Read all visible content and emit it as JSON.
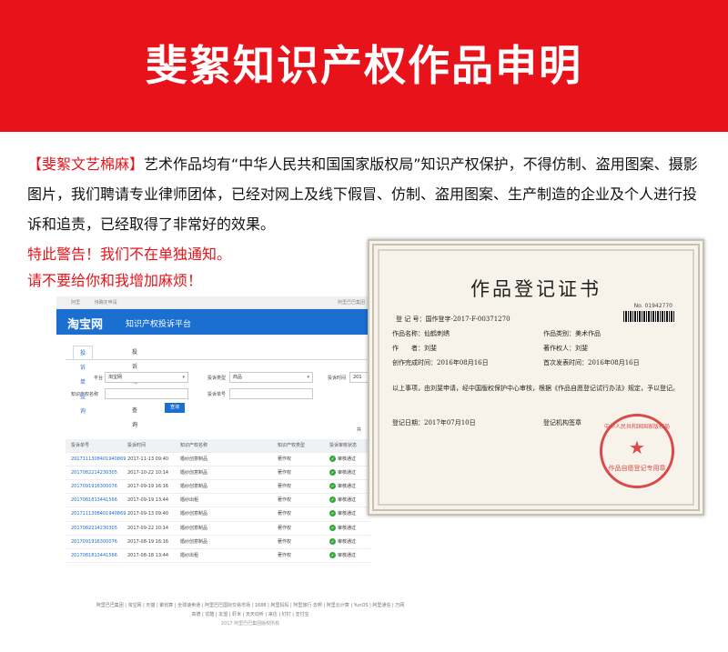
{
  "banner": {
    "title": "斐絮知识产权作品申明"
  },
  "intro": {
    "brand": "【斐絮文艺棉麻】",
    "text": "艺术作品均有“中华人民共和国国家版权局”知识产权保护，不得仿制、盗用图案、摄影图片，我们聘请专业律师团体，已经对网上及线下假冒、仿制、盗用图案、生产制造的企业及个人进行投诉和追责，已经取得了非常好的效果。"
  },
  "warnings": [
    "特此警告！我们不在单独通知。",
    "请不要给你和我增加麻烦！"
  ],
  "taobao": {
    "top_left": "阿里",
    "top_mid": "待确定申请",
    "top_right": "阿里巴巴集团",
    "logo": "淘宝网",
    "subtitle": "知识产权投诉平台",
    "tabs": [
      "投诉单查询",
      "投诉链接查询"
    ],
    "filters": {
      "platform_label": "平台",
      "platform_value": "淘宝网",
      "type_label": "投诉类型",
      "type_value": "商品",
      "time_label": "投诉时间",
      "time_value": "201",
      "ip_label": "知识产权名称",
      "no_label": "投诉单号",
      "search_button": "查询"
    },
    "table_hint": "共",
    "headers": [
      "投诉单号",
      "投诉时间",
      "知识产权名称",
      "知识产权类型",
      "投诉审核状态"
    ],
    "rows": [
      {
        "id": "2017111308401940869",
        "time": "2017-11-13 09:40",
        "name": "婚纱创意制品",
        "type": "著作权",
        "status": "审核通过",
        "action": ""
      },
      {
        "id": "2017082214230305",
        "time": "2017-10-22 10:14",
        "name": "婚纱创意制品",
        "type": "著作权",
        "status": "审核通过",
        "action": ""
      },
      {
        "id": "2017091916300076",
        "time": "2017-09-19 16:16",
        "name": "婚纱创意制品",
        "type": "著作权",
        "status": "审核通过",
        "action": ""
      },
      {
        "id": "2017081813441566",
        "time": "2017-09-19 13:44",
        "name": "婚纱出租",
        "type": "著作权",
        "status": "审核通过",
        "action": "查看"
      },
      {
        "id": "2017111308401940869",
        "time": "2017-09-13 09:40",
        "name": "婚纱创意制品",
        "type": "著作权",
        "status": "审核通过",
        "action": "查看"
      },
      {
        "id": "2017082214230305",
        "time": "2017-09-22 10:14",
        "name": "婚纱创意制品",
        "type": "著作权",
        "status": "审核通过",
        "action": "查看"
      },
      {
        "id": "2017091916300076",
        "time": "2017-08-19 16:16",
        "name": "婚纱创意制品",
        "type": "著作权",
        "status": "审核通过",
        "action": "查看"
      },
      {
        "id": "2017081813441566",
        "time": "2017-08-18 13:44",
        "name": "婚纱出租",
        "type": "著作权",
        "status": "审核通过",
        "action": "查看"
      }
    ],
    "footer1": "阿里巴巴集团 | 淘宝网 | 天猫 | 聚划算 | 全球速卖通 | 阿里巴巴国际交易市场 | 1688 | 阿里妈妈 | 阿里旅行·去啊 | 阿里云计算 | YunOS | 阿里通信 | 万网",
    "footer2": "高德 | 优酷 | 友盟 | 虾米 | 天天动听 | 来往 | 钉钉 | 支付宝",
    "footer3": "2017 阿里巴巴集团版权所有"
  },
  "certificate": {
    "title": "作品登记证书",
    "no": "No. 01942770",
    "reg_no": "登 记 号：国作登字-2017-F-00371270",
    "work_name": "作品名称：仙鹤刺绣",
    "category": "作品类别：美术作品",
    "author": "作　　者：刘斐",
    "owner": "著作权人：刘斐",
    "created": "创作完成时间：2016年08月16日",
    "published": "首次发表时间：2016年08月16日",
    "body": "以上事项，由刘斐申请，经中国版权保护中心审核，根据《作品自愿登记试行办法》规定，予以登记。",
    "reg_date": "登记日期：2017年07月10日",
    "agency": "登记机构签章",
    "stamp_top": "中华人民共和国国家版权局",
    "stamp_bottom": "作品自愿登记专用章"
  }
}
